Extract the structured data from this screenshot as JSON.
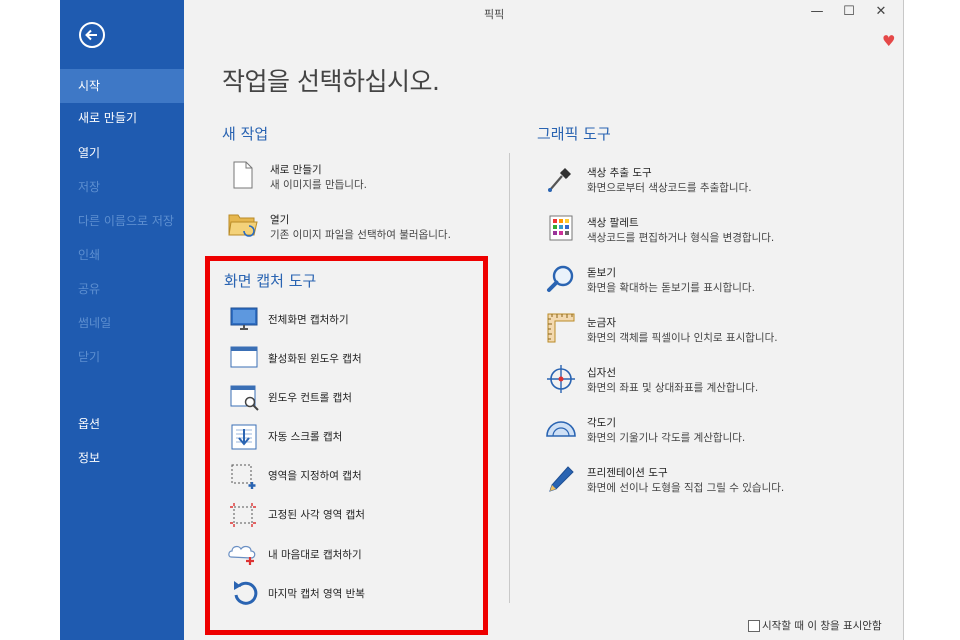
{
  "window": {
    "title": "픽픽"
  },
  "controls": {
    "minimize": "—",
    "maximize": "☐",
    "close": "✕"
  },
  "heart": "♥",
  "sidebar": {
    "items": [
      {
        "label": "시작"
      },
      {
        "label": "새로 만들기"
      },
      {
        "label": "열기"
      },
      {
        "label": "저장"
      },
      {
        "label": "다른 이름으로 저장"
      },
      {
        "label": "인쇄"
      },
      {
        "label": "공유"
      },
      {
        "label": "썸네일"
      },
      {
        "label": "닫기"
      },
      {
        "label": "옵션"
      },
      {
        "label": "정보"
      }
    ]
  },
  "main": {
    "heading": "작업을 선택하십시오.",
    "new_task": {
      "title": "새 작업",
      "items": [
        {
          "title": "새로 만들기",
          "desc": "새 이미지를 만듭니다."
        },
        {
          "title": "열기",
          "desc": "기존 이미지 파일을 선택하여 불러옵니다."
        }
      ]
    },
    "capture": {
      "title": "화면 캡처 도구",
      "items": [
        {
          "label": "전체화면 캡처하기"
        },
        {
          "label": "활성화된 윈도우 캡처"
        },
        {
          "label": "윈도우 컨트롤 캡처"
        },
        {
          "label": "자동 스크롤 캡처"
        },
        {
          "label": "영역을 지정하여 캡처"
        },
        {
          "label": "고정된 사각 영역 캡처"
        },
        {
          "label": "내 마음대로 캡처하기"
        },
        {
          "label": "마지막 캡처 영역 반복"
        }
      ]
    },
    "graphics": {
      "title": "그래픽 도구",
      "items": [
        {
          "title": "색상 추출 도구",
          "desc": "화면으로부터 색상코드를 추출합니다."
        },
        {
          "title": "색상 팔레트",
          "desc": "색상코드를 편집하거나 형식을 변경합니다."
        },
        {
          "title": "돋보기",
          "desc": "화면을 확대하는 돋보기를 표시합니다."
        },
        {
          "title": "눈금자",
          "desc": "화면의 객체를 픽셀이나 인치로 표시합니다."
        },
        {
          "title": "십자선",
          "desc": "화면의 좌표 및 상대좌표를 계산합니다."
        },
        {
          "title": "각도기",
          "desc": "화면의 기울기나 각도를 계산합니다."
        },
        {
          "title": "프리젠테이션 도구",
          "desc": "화면에 선이나 도형을 직접 그릴 수 있습니다."
        }
      ]
    }
  },
  "footer": {
    "checkbox_label": "시작할 때 이 창을 표시안함",
    "checked": false
  }
}
